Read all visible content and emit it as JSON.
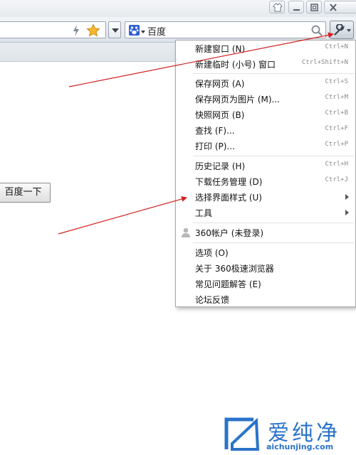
{
  "search": {
    "engine_name": "百度",
    "engine_icon": "baidu-paw-icon"
  },
  "page": {
    "search_button_label": "百度一下"
  },
  "menu": {
    "items": [
      {
        "label": "新建窗口 (N)",
        "shortcut": "Ctrl+N"
      },
      {
        "label": "新建临时 (小号) 窗口",
        "shortcut": "Ctrl+Shift+N"
      },
      {
        "label": "保存网页 (A)",
        "shortcut": "Ctrl+S"
      },
      {
        "label": "保存网页为图片 (M)...",
        "shortcut": "Ctrl+M"
      },
      {
        "label": "快照网页 (B)",
        "shortcut": "Ctrl+B"
      },
      {
        "label": "查找 (F)...",
        "shortcut": "Ctrl+F"
      },
      {
        "label": "打印 (P)...",
        "shortcut": "Ctrl+P"
      },
      {
        "label": "历史记录 (H)",
        "shortcut": "Ctrl+H"
      },
      {
        "label": "下载任务管理 (D)",
        "shortcut": "Ctrl+J"
      },
      {
        "label": "选择界面样式 (U)",
        "shortcut": ""
      },
      {
        "label": "工具",
        "shortcut": ""
      },
      {
        "label": "360帐户 (未登录)",
        "shortcut": ""
      },
      {
        "label": "选项 (O)",
        "shortcut": ""
      },
      {
        "label": "关于 360极速浏览器",
        "shortcut": ""
      },
      {
        "label": "常见问题解答 (E)",
        "shortcut": ""
      },
      {
        "label": "论坛反馈",
        "shortcut": ""
      }
    ]
  },
  "watermark": {
    "title": "爱纯净",
    "url": "aichunjing.com"
  },
  "colors": {
    "arrow": "#d42020",
    "watermark": "#2a73c9",
    "search_engine": "#2f5fd4"
  }
}
